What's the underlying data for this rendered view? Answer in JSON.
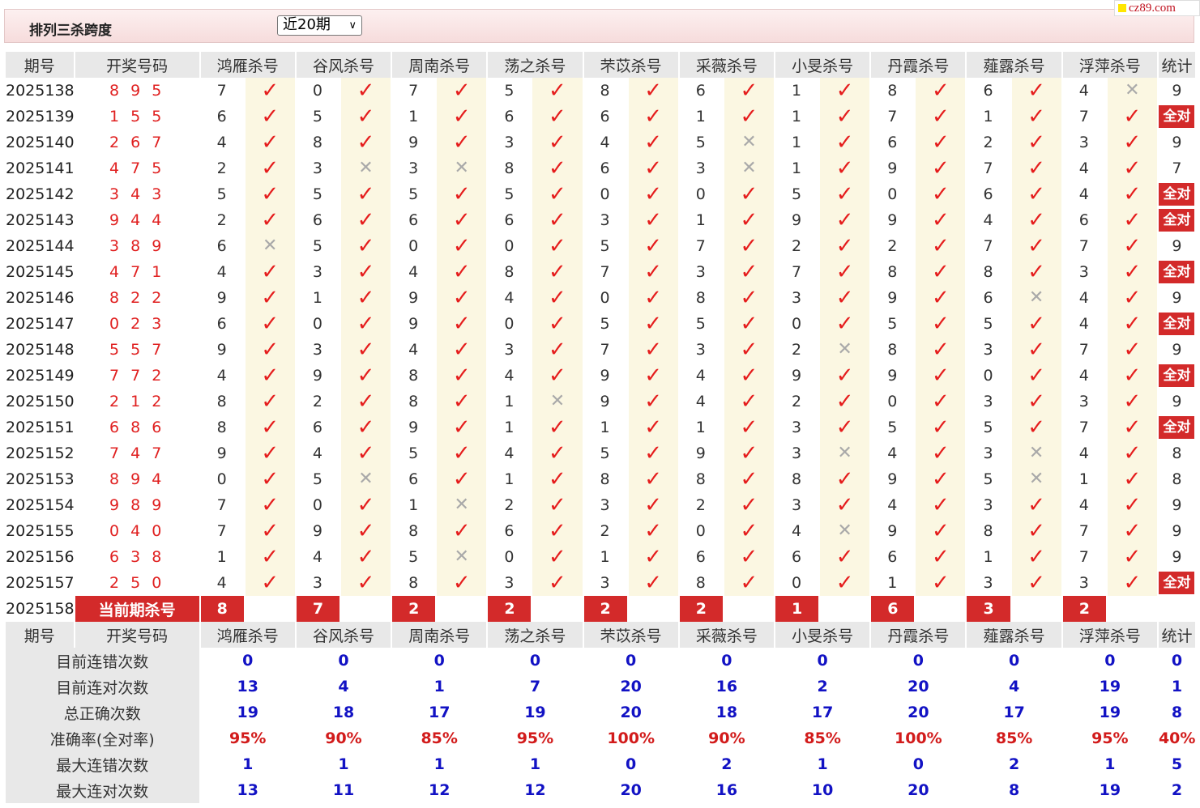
{
  "header": {
    "title": "排列三杀跨度",
    "period_select_value": "近20期",
    "brand": "cz89.com"
  },
  "columns": {
    "issue": "期号",
    "draw": "开奖号码",
    "experts": [
      "鸿雁杀号",
      "谷风杀号",
      "周南杀号",
      "荡之杀号",
      "芣苡杀号",
      "采薇杀号",
      "小旻杀号",
      "丹霞杀号",
      "薤露杀号",
      "浮萍杀号"
    ],
    "stat": "统计"
  },
  "rows": [
    {
      "issue": "2025138",
      "draw": "8 9 5",
      "picks": [
        7,
        0,
        7,
        5,
        8,
        6,
        1,
        8,
        6,
        4
      ],
      "hits": [
        1,
        1,
        1,
        1,
        1,
        1,
        1,
        1,
        1,
        0
      ],
      "stat": "9"
    },
    {
      "issue": "2025139",
      "draw": "1 5 5",
      "picks": [
        6,
        5,
        1,
        6,
        6,
        1,
        1,
        7,
        1,
        7
      ],
      "hits": [
        1,
        1,
        1,
        1,
        1,
        1,
        1,
        1,
        1,
        1
      ],
      "stat": "全对"
    },
    {
      "issue": "2025140",
      "draw": "2 6 7",
      "picks": [
        4,
        8,
        9,
        3,
        4,
        5,
        1,
        6,
        2,
        3
      ],
      "hits": [
        1,
        1,
        1,
        1,
        1,
        0,
        1,
        1,
        1,
        1
      ],
      "stat": "9"
    },
    {
      "issue": "2025141",
      "draw": "4 7 5",
      "picks": [
        2,
        3,
        3,
        8,
        6,
        3,
        1,
        9,
        7,
        4
      ],
      "hits": [
        1,
        0,
        0,
        1,
        1,
        0,
        1,
        1,
        1,
        1
      ],
      "stat": "7"
    },
    {
      "issue": "2025142",
      "draw": "3 4 3",
      "picks": [
        5,
        5,
        5,
        5,
        0,
        0,
        5,
        0,
        6,
        4
      ],
      "hits": [
        1,
        1,
        1,
        1,
        1,
        1,
        1,
        1,
        1,
        1
      ],
      "stat": "全对"
    },
    {
      "issue": "2025143",
      "draw": "9 4 4",
      "picks": [
        2,
        6,
        6,
        6,
        3,
        1,
        9,
        9,
        4,
        6
      ],
      "hits": [
        1,
        1,
        1,
        1,
        1,
        1,
        1,
        1,
        1,
        1
      ],
      "stat": "全对"
    },
    {
      "issue": "2025144",
      "draw": "3 8 9",
      "picks": [
        6,
        5,
        0,
        0,
        5,
        7,
        2,
        2,
        7,
        7
      ],
      "hits": [
        0,
        1,
        1,
        1,
        1,
        1,
        1,
        1,
        1,
        1
      ],
      "stat": "9"
    },
    {
      "issue": "2025145",
      "draw": "4 7 1",
      "picks": [
        4,
        3,
        4,
        8,
        7,
        3,
        7,
        8,
        8,
        3
      ],
      "hits": [
        1,
        1,
        1,
        1,
        1,
        1,
        1,
        1,
        1,
        1
      ],
      "stat": "全对"
    },
    {
      "issue": "2025146",
      "draw": "8 2 2",
      "picks": [
        9,
        1,
        9,
        4,
        0,
        8,
        3,
        9,
        6,
        4
      ],
      "hits": [
        1,
        1,
        1,
        1,
        1,
        1,
        1,
        1,
        0,
        1
      ],
      "stat": "9"
    },
    {
      "issue": "2025147",
      "draw": "0 2 3",
      "picks": [
        6,
        0,
        9,
        0,
        5,
        5,
        0,
        5,
        5,
        4
      ],
      "hits": [
        1,
        1,
        1,
        1,
        1,
        1,
        1,
        1,
        1,
        1
      ],
      "stat": "全对"
    },
    {
      "issue": "2025148",
      "draw": "5 5 7",
      "picks": [
        9,
        3,
        4,
        3,
        7,
        3,
        2,
        8,
        3,
        7
      ],
      "hits": [
        1,
        1,
        1,
        1,
        1,
        1,
        0,
        1,
        1,
        1
      ],
      "stat": "9"
    },
    {
      "issue": "2025149",
      "draw": "7 7 2",
      "picks": [
        4,
        9,
        8,
        4,
        9,
        4,
        9,
        9,
        0,
        4
      ],
      "hits": [
        1,
        1,
        1,
        1,
        1,
        1,
        1,
        1,
        1,
        1
      ],
      "stat": "全对"
    },
    {
      "issue": "2025150",
      "draw": "2 1 2",
      "picks": [
        8,
        2,
        8,
        1,
        9,
        4,
        2,
        0,
        3,
        3
      ],
      "hits": [
        1,
        1,
        1,
        0,
        1,
        1,
        1,
        1,
        1,
        1
      ],
      "stat": "9"
    },
    {
      "issue": "2025151",
      "draw": "6 8 6",
      "picks": [
        8,
        6,
        9,
        1,
        1,
        1,
        3,
        5,
        5,
        7
      ],
      "hits": [
        1,
        1,
        1,
        1,
        1,
        1,
        1,
        1,
        1,
        1
      ],
      "stat": "全对"
    },
    {
      "issue": "2025152",
      "draw": "7 4 7",
      "picks": [
        9,
        4,
        5,
        4,
        5,
        9,
        3,
        4,
        3,
        4
      ],
      "hits": [
        1,
        1,
        1,
        1,
        1,
        1,
        0,
        1,
        0,
        1
      ],
      "stat": "8"
    },
    {
      "issue": "2025153",
      "draw": "8 9 4",
      "picks": [
        0,
        5,
        6,
        1,
        8,
        8,
        8,
        9,
        5,
        1
      ],
      "hits": [
        1,
        0,
        1,
        1,
        1,
        1,
        1,
        1,
        0,
        1
      ],
      "stat": "8"
    },
    {
      "issue": "2025154",
      "draw": "9 8 9",
      "picks": [
        7,
        0,
        1,
        2,
        3,
        2,
        3,
        4,
        3,
        4
      ],
      "hits": [
        1,
        1,
        0,
        1,
        1,
        1,
        1,
        1,
        1,
        1
      ],
      "stat": "9"
    },
    {
      "issue": "2025155",
      "draw": "0 4 0",
      "picks": [
        7,
        9,
        8,
        6,
        2,
        0,
        4,
        9,
        8,
        7
      ],
      "hits": [
        1,
        1,
        1,
        1,
        1,
        1,
        0,
        1,
        1,
        1
      ],
      "stat": "9"
    },
    {
      "issue": "2025156",
      "draw": "6 3 8",
      "picks": [
        1,
        4,
        5,
        0,
        1,
        6,
        6,
        6,
        1,
        7
      ],
      "hits": [
        1,
        1,
        0,
        1,
        1,
        1,
        1,
        1,
        1,
        1
      ],
      "stat": "9"
    },
    {
      "issue": "2025157",
      "draw": "2 5 0",
      "picks": [
        4,
        3,
        8,
        3,
        3,
        8,
        0,
        1,
        3,
        3
      ],
      "hits": [
        1,
        1,
        1,
        1,
        1,
        1,
        1,
        1,
        1,
        1
      ],
      "stat": "全对"
    }
  ],
  "current": {
    "issue": "2025158",
    "label": "当前期杀号",
    "picks": [
      "8",
      "7",
      "2",
      "2",
      "2",
      "2",
      "1",
      "6",
      "3",
      "2"
    ]
  },
  "summary": [
    {
      "label": "目前连错次数",
      "values": [
        "0",
        "0",
        "0",
        "0",
        "0",
        "0",
        "0",
        "0",
        "0",
        "0"
      ],
      "stat": "0",
      "red": false
    },
    {
      "label": "目前连对次数",
      "values": [
        "13",
        "4",
        "1",
        "7",
        "20",
        "16",
        "2",
        "20",
        "4",
        "19"
      ],
      "stat": "1",
      "red": false
    },
    {
      "label": "总正确次数",
      "values": [
        "19",
        "18",
        "17",
        "19",
        "20",
        "18",
        "17",
        "20",
        "17",
        "19"
      ],
      "stat": "8",
      "red": false
    },
    {
      "label": "准确率(全对率)",
      "values": [
        "95%",
        "90%",
        "85%",
        "95%",
        "100%",
        "90%",
        "85%",
        "100%",
        "85%",
        "95%"
      ],
      "stat": "40%",
      "red": true
    },
    {
      "label": "最大连错次数",
      "values": [
        "1",
        "1",
        "1",
        "1",
        "0",
        "2",
        "1",
        "0",
        "2",
        "1"
      ],
      "stat": "5",
      "red": false
    },
    {
      "label": "最大连对次数",
      "values": [
        "13",
        "11",
        "12",
        "12",
        "20",
        "16",
        "10",
        "20",
        "8",
        "19"
      ],
      "stat": "2",
      "red": false
    }
  ],
  "symbols": {
    "hit": "✓",
    "miss": "✕"
  },
  "colors": {
    "accent_red": "#d32a2a",
    "check_red": "#e51d1d",
    "summary_blue": "#1212c4",
    "mark_bg": "#fbf7e2",
    "header_bg": "#e8e8e8"
  }
}
